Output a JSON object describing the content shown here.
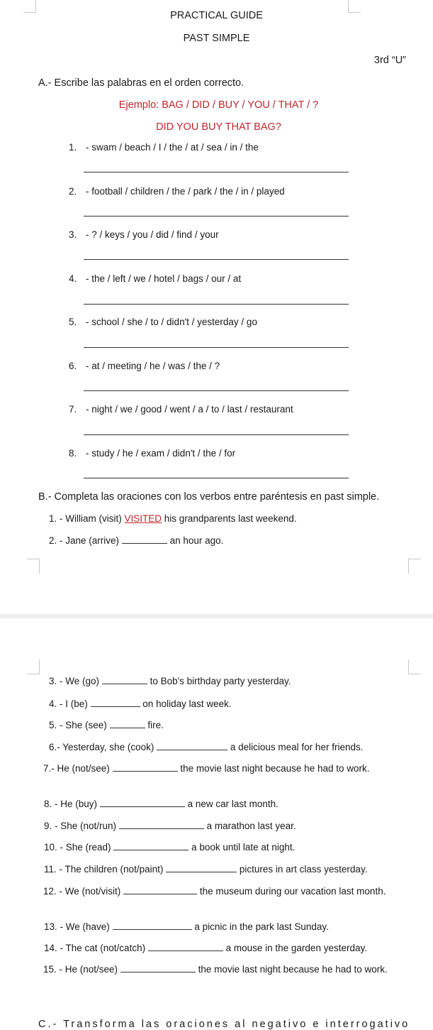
{
  "header": {
    "title": "PRACTICAL GUIDE",
    "subtitle": "PAST SIMPLE",
    "grade": "3rd “U”"
  },
  "section_a": {
    "instruction": "A.- Escribe las palabras en el orden correcto.",
    "example_prompt": "Ejemplo: BAG / DID / BUY / YOU / THAT / ?",
    "example_answer": "DID YOU BUY THAT BAG?",
    "items": [
      {
        "num": "1.",
        "words": "- swam / beach / I / the / at / sea / in / the",
        "answer": ""
      },
      {
        "num": "2.",
        "words": "- football / children / the / park / the / in / played",
        "answer": ""
      },
      {
        "num": "3.",
        "words": "- ? / keys / you / did / find / your",
        "answer": ""
      },
      {
        "num": "4.",
        "words": "- the / left / we / hotel / bags / our / at",
        "answer": ""
      },
      {
        "num": "5.",
        "words": "- school / she / to / didn't / yesterday / go",
        "answer": ""
      },
      {
        "num": "6.",
        "words": "- at / meeting / he / was / the / ?",
        "answer": ""
      },
      {
        "num": "7.",
        "words": "- night / we / good / went / a / to / last / restaurant",
        "answer": ""
      },
      {
        "num": "8.",
        "words": "- study / he / exam / didn't / the / for",
        "answer": ""
      }
    ]
  },
  "section_b": {
    "instruction": "B.- Completa las oraciones con los verbos entre paréntesis en past simple.",
    "items": [
      {
        "before": "1. - William (visit)",
        "answer": "VISITED",
        "after": "his grandparents last weekend."
      },
      {
        "before": "2. - Jane (arrive)",
        "answer": "",
        "after": "an hour ago."
      },
      {
        "before": "3. - We (go)",
        "answer": "",
        "after": "to Bob's birthday party yesterday."
      },
      {
        "before": "4. - I (be)",
        "answer": "",
        "after": "on holiday last week."
      },
      {
        "before": "5. - She (see)",
        "answer": "",
        "after": "fire."
      },
      {
        "before": "6.- Yesterday, she (cook)",
        "answer": "",
        "after": "a delicious meal for her friends."
      },
      {
        "before": "7.- He (not/see)",
        "answer": "",
        "after": "the movie last night because he had to work."
      },
      {
        "before": "8. - He (buy)",
        "answer": "",
        "after": "a new car last month."
      },
      {
        "before": "9. - She (not/run)",
        "answer": "",
        "after": "a marathon last year."
      },
      {
        "before": "10. - She (read)",
        "answer": "",
        "after": "a book until late at night."
      },
      {
        "before": "11. - The children (not/paint)",
        "answer": "",
        "after": "pictures in art class yesterday."
      },
      {
        "before": "12. - We (not/visit)",
        "answer": "",
        "after": "the museum during our vacation last month."
      },
      {
        "before": "13. - We (have)",
        "answer": "",
        "after": "a picnic in the park last Sunday."
      },
      {
        "before": "14. - The cat (not/catch)",
        "answer": "",
        "after": "a mouse in the garden yesterday."
      },
      {
        "before": "15. - He (not/see)",
        "answer": "",
        "after": "the movie last night because he had to work."
      }
    ]
  },
  "section_c": {
    "instruction_partial": "C.- Transforma las oraciones al negativo e interrogativo"
  },
  "colors": {
    "accent_red": "#c0262c",
    "page_gap": "#eeeeee",
    "corner_marks": "#c8c8c8"
  }
}
